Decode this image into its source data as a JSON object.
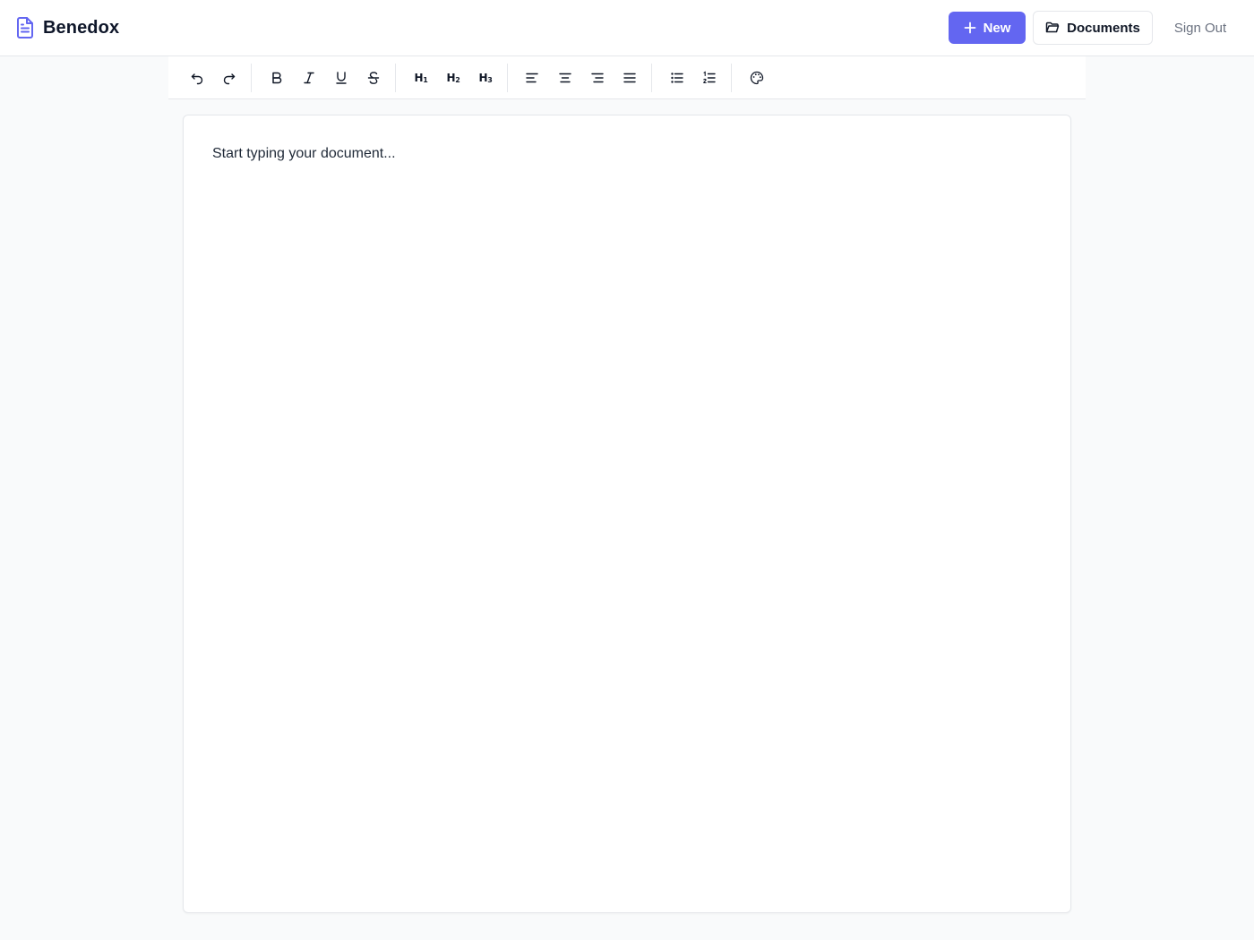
{
  "app": {
    "name": "Benedox",
    "brand_icon": "document-icon",
    "accent_color": "#6366f1"
  },
  "header": {
    "new_button": {
      "label": "New",
      "icon": "plus-icon"
    },
    "documents_button": {
      "label": "Documents",
      "icon": "folder-icon"
    },
    "signout_button": {
      "label": "Sign Out"
    }
  },
  "toolbar": {
    "groups": [
      [
        "undo-icon",
        "redo-icon"
      ],
      [
        "bold-icon",
        "italic-icon",
        "underline-icon",
        "strikethrough-icon"
      ],
      [
        "heading-1-icon",
        "heading-2-icon",
        "heading-3-icon"
      ],
      [
        "align-left-icon",
        "align-center-icon",
        "align-right-icon",
        "align-justify-icon"
      ],
      [
        "bullet-list-icon",
        "numbered-list-icon"
      ],
      [
        "palette-icon"
      ]
    ],
    "heading_labels": {
      "h1": "H",
      "h2": "H",
      "h3": "H",
      "h1_num": "1",
      "h2_num": "2",
      "h3_num": "3"
    }
  },
  "editor": {
    "placeholder": "Start typing your document..."
  }
}
